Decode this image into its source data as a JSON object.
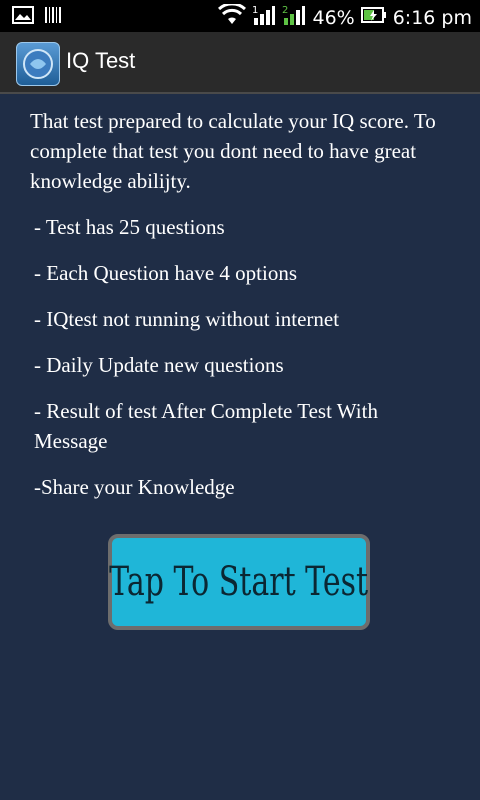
{
  "status_bar": {
    "battery_percent": "46%",
    "time": "6:16 pm",
    "icons": [
      "gallery-icon",
      "barcode-icon",
      "wifi-icon",
      "signal-1-icon",
      "signal-2-icon",
      "battery-icon"
    ]
  },
  "action_bar": {
    "title": "IQ Test",
    "icon": "app-logo-icon"
  },
  "main": {
    "intro": "That test prepared to calculate your IQ score. To complete that test you dont need to have great knowledge abilijty.",
    "bullets": [
      "- Test has 25 questions",
      "- Each Question have 4 options",
      "- IQtest not running without internet",
      "- Daily Update new questions",
      "- Result of test After Complete Test With Message",
      "-Share your Knowledge"
    ],
    "start_button_label": "Tap To Start Test"
  },
  "colors": {
    "background": "#1f2d46",
    "button": "#1fb6d8",
    "button_border": "#6d6d6d"
  }
}
